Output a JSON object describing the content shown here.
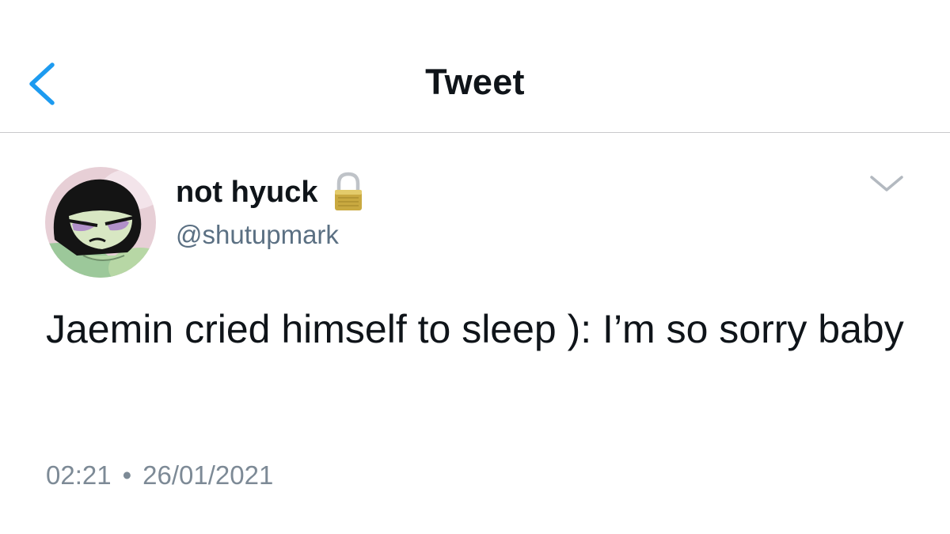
{
  "nav": {
    "title": "Tweet",
    "back_icon": "chevron-left-icon",
    "accent_color": "#1d9bf0"
  },
  "tweet": {
    "display_name": "not hyuck",
    "protected_icon": "lock-icon",
    "handle": "@shutupmark",
    "text": "Jaemin cried himself to sleep ): I’m so sorry baby",
    "time": "02:21",
    "separator": "•",
    "date": "26/01/2021",
    "more_icon": "chevron-down-icon"
  },
  "colors": {
    "text_primary": "#0f1419",
    "text_secondary": "#5b7083",
    "divider": "#c9c9cc"
  }
}
